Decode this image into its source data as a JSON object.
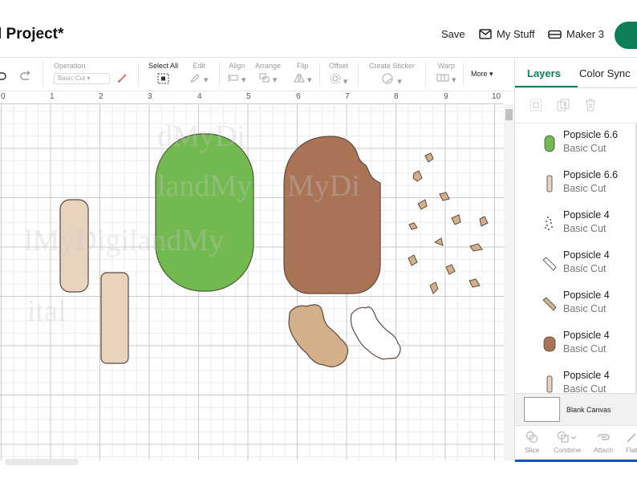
{
  "header": {
    "title": "l Project*",
    "save_label": "Save",
    "mystuff_label": "My Stuff",
    "machine_label": "Maker 3",
    "accent": "#0d7f56"
  },
  "toolbar": {
    "undo_icon": "undo-icon",
    "redo_icon": "redo-icon",
    "operation": {
      "label": "Operation",
      "value": "Basic Cut"
    },
    "select_all": "Select All",
    "edit": "Edit",
    "align": "Align",
    "arrange": "Arrange",
    "flip": "Flip",
    "offset": "Offset",
    "create_sticker": "Create Sticker",
    "warp": "Warp",
    "more": "More"
  },
  "ruler": {
    "numbers": [
      "0",
      "1",
      "2",
      "3",
      "4",
      "5",
      "6",
      "7",
      "8",
      "9",
      "10"
    ]
  },
  "canvas": {
    "watermark": [
      "dMyDi",
      "landMy",
      "lMyDigilandMy",
      "landMyDigilandMy",
      "MyDi",
      "ital"
    ],
    "colors": {
      "green": "#72b94f",
      "brown": "#a97456",
      "stick": "#e8d3bf",
      "bite": "#d4b08a",
      "white": "#ffffff",
      "outline": "#5b4a3e"
    }
  },
  "panel": {
    "tabs": [
      "Layers",
      "Color Sync"
    ],
    "layers": [
      {
        "name": "Popsicle 6.6",
        "type": "Basic Cut",
        "thumb": "green-pill"
      },
      {
        "name": "Popsicle 6.6",
        "type": "Basic Cut",
        "thumb": "stick"
      },
      {
        "name": "Popsicle 4",
        "type": "Basic Cut",
        "thumb": "crumbs"
      },
      {
        "name": "Popsicle 4",
        "type": "Basic Cut",
        "thumb": "white-bite"
      },
      {
        "name": "Popsicle 4",
        "type": "Basic Cut",
        "thumb": "tan-bite"
      },
      {
        "name": "Popsicle 4",
        "type": "Basic Cut",
        "thumb": "brown-pill"
      },
      {
        "name": "Popsicle 4",
        "type": "Basic Cut",
        "thumb": "stick"
      }
    ],
    "blank_canvas": "Blank Canvas",
    "bottom": [
      "Slice",
      "Combine",
      "Attach",
      "Flat"
    ]
  }
}
